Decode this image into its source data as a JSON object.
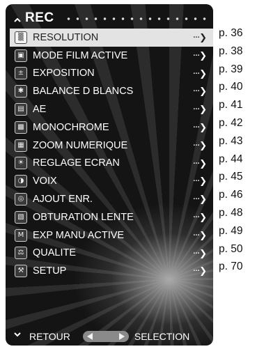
{
  "header": {
    "title": "REC"
  },
  "menu": {
    "items": [
      {
        "label": "RESOLUTION",
        "icon": "resolution-icon",
        "glyph": "▒"
      },
      {
        "label": "MODE FILM  ACTIVE",
        "icon": "movie-camera-icon",
        "glyph": "▣"
      },
      {
        "label": "EXPOSITION",
        "icon": "exposure-compensation-icon",
        "glyph": "±"
      },
      {
        "label": "BALANCE D BLANCS",
        "icon": "white-balance-icon",
        "glyph": "✱"
      },
      {
        "label": "AE",
        "icon": "ae-lock-icon",
        "glyph": "▤"
      },
      {
        "label": "MONOCHROME",
        "icon": "monochrome-icon",
        "glyph": "▩"
      },
      {
        "label": "ZOOM NUMERIQUE",
        "icon": "digital-zoom-icon",
        "glyph": "▦"
      },
      {
        "label": "REGLAGE ECRAN",
        "icon": "screen-adjust-icon",
        "glyph": "☀"
      },
      {
        "label": "VOIX",
        "icon": "voice-icon",
        "glyph": "◑"
      },
      {
        "label": "AJOUT ENR.",
        "icon": "add-record-icon",
        "glyph": "◎"
      },
      {
        "label": "OBTURATION LENTE",
        "icon": "slow-shutter-icon",
        "glyph": "▧"
      },
      {
        "label": "EXP MANU ACTIVE",
        "icon": "manual-exposure-icon",
        "glyph": "M"
      },
      {
        "label": "QUALITE",
        "icon": "quality-icon",
        "glyph": "⚖"
      },
      {
        "label": "SETUP",
        "icon": "setup-icon",
        "glyph": "⚒"
      }
    ],
    "arrow": "···❯"
  },
  "footer": {
    "retour": "RETOUR",
    "selection": "SELECTION"
  },
  "pages": [
    "p. 36",
    "p. 38",
    "p. 39",
    "p. 40",
    "p. 41",
    "p. 42",
    "p. 43",
    "p. 44",
    "p. 45",
    "p. 46",
    "p. 48",
    "p. 49",
    "p. 50",
    "p. 70"
  ]
}
